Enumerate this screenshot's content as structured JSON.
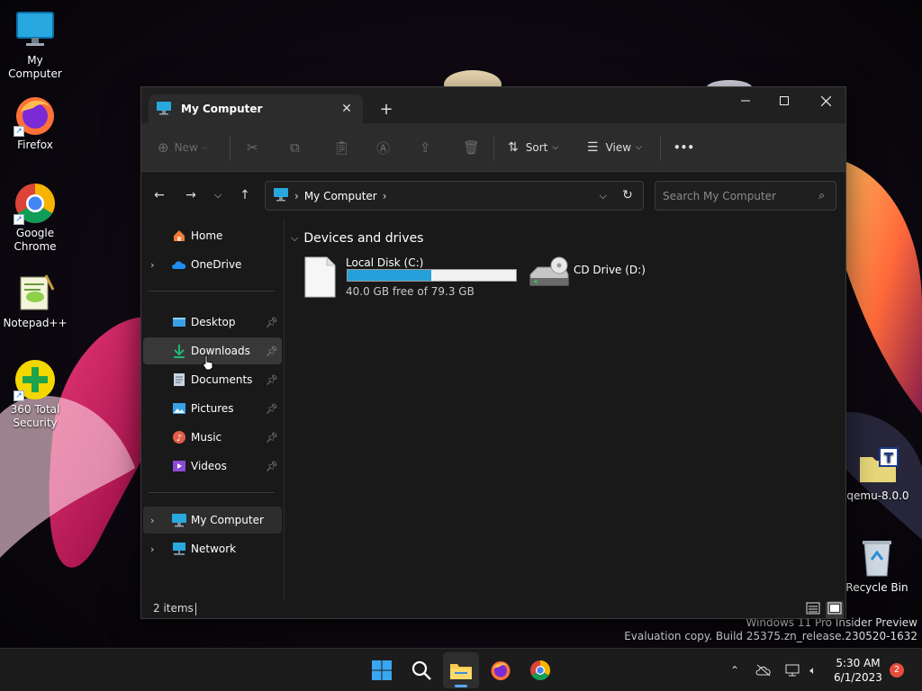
{
  "desktop": {
    "icons": [
      {
        "label": "My Computer"
      },
      {
        "label": "Firefox"
      },
      {
        "label": "Google\nChrome"
      },
      {
        "label": "Notepad++"
      },
      {
        "label": "360 Total\nSecurity"
      },
      {
        "label": "qemu-8.0.0"
      },
      {
        "label": "Recycle Bin"
      }
    ]
  },
  "window": {
    "tab_title": "My Computer",
    "toolbar": {
      "new_label": "New",
      "sort_label": "Sort",
      "view_label": "View",
      "more_label": "•••"
    },
    "address": {
      "crumb": "My Computer"
    },
    "search": {
      "placeholder": "Search My Computer"
    },
    "sidebar": {
      "top": [
        {
          "label": "Home",
          "icon": "home-icon"
        },
        {
          "label": "OneDrive",
          "icon": "onedrive-icon"
        }
      ],
      "quick": [
        {
          "label": "Desktop",
          "icon": "desktop-folder-icon"
        },
        {
          "label": "Downloads",
          "icon": "downloads-icon"
        },
        {
          "label": "Documents",
          "icon": "documents-icon"
        },
        {
          "label": "Pictures",
          "icon": "pictures-icon"
        },
        {
          "label": "Music",
          "icon": "music-icon"
        },
        {
          "label": "Videos",
          "icon": "videos-icon"
        }
      ],
      "bottom": [
        {
          "label": "My Computer",
          "icon": "computer-icon"
        },
        {
          "label": "Network",
          "icon": "network-icon"
        }
      ]
    },
    "content": {
      "group_title": "Devices and drives",
      "drives": [
        {
          "name": "Local Disk (C:)",
          "info": "40.0 GB free of 79.3 GB",
          "used_fraction": 0.496
        },
        {
          "name": "CD Drive (D:)"
        }
      ]
    },
    "status": {
      "items": "2 items"
    }
  },
  "watermark": {
    "line1": "Windows 11 Pro Insider Preview",
    "line2": "Evaluation copy. Build 25375.zn_release.230520-1632"
  },
  "taskbar": {
    "time": "5:30 AM",
    "date": "6/1/2023",
    "notifications": "2"
  },
  "colors": {
    "accent": "#26a0da",
    "window_bg": "#191919",
    "toolbar_bg": "#2c2c2c"
  }
}
